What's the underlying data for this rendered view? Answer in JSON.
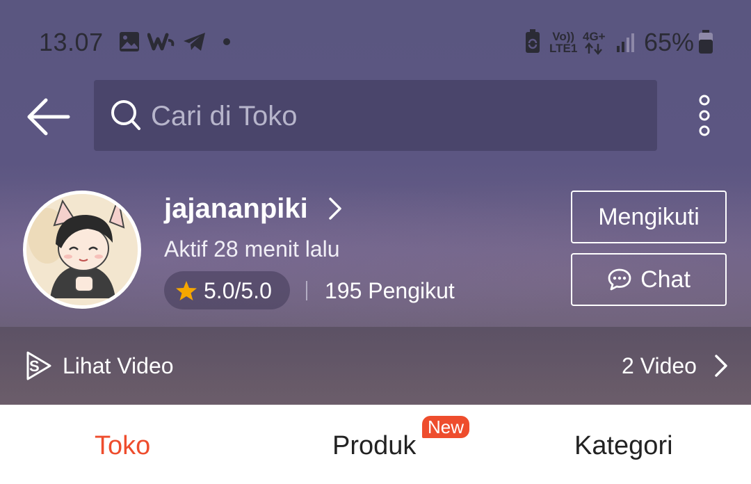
{
  "status_bar": {
    "time": "13.07",
    "left_icons": [
      "image-icon",
      "w-app-icon",
      "telegram-icon",
      "dot-icon"
    ],
    "right_icons": [
      "battery-saver-icon",
      "volte-icon",
      "4g-icon",
      "signal-icon",
      "battery-icon"
    ],
    "volte_label_top": "Vo))",
    "volte_label_bottom": "LTE1",
    "network_label": "4G+",
    "battery_percent": "65%"
  },
  "search": {
    "placeholder": "Cari di Toko"
  },
  "shop": {
    "name": "jajananpiki",
    "last_active": "Aktif 28 menit lalu",
    "rating": "5.0/5.0",
    "followers": "195 Pengikut",
    "follow_button": "Mengikuti",
    "chat_button": "Chat"
  },
  "video": {
    "label": "Lihat Video",
    "count": "2 Video"
  },
  "tabs": [
    {
      "label": "Toko",
      "active": true
    },
    {
      "label": "Produk",
      "active": false,
      "badge": "New"
    },
    {
      "label": "Kategori",
      "active": false
    }
  ],
  "colors": {
    "accent": "#ee4d2d",
    "hero_bg": "#5c5682",
    "white": "#ffffff",
    "star": "#f6a700"
  }
}
